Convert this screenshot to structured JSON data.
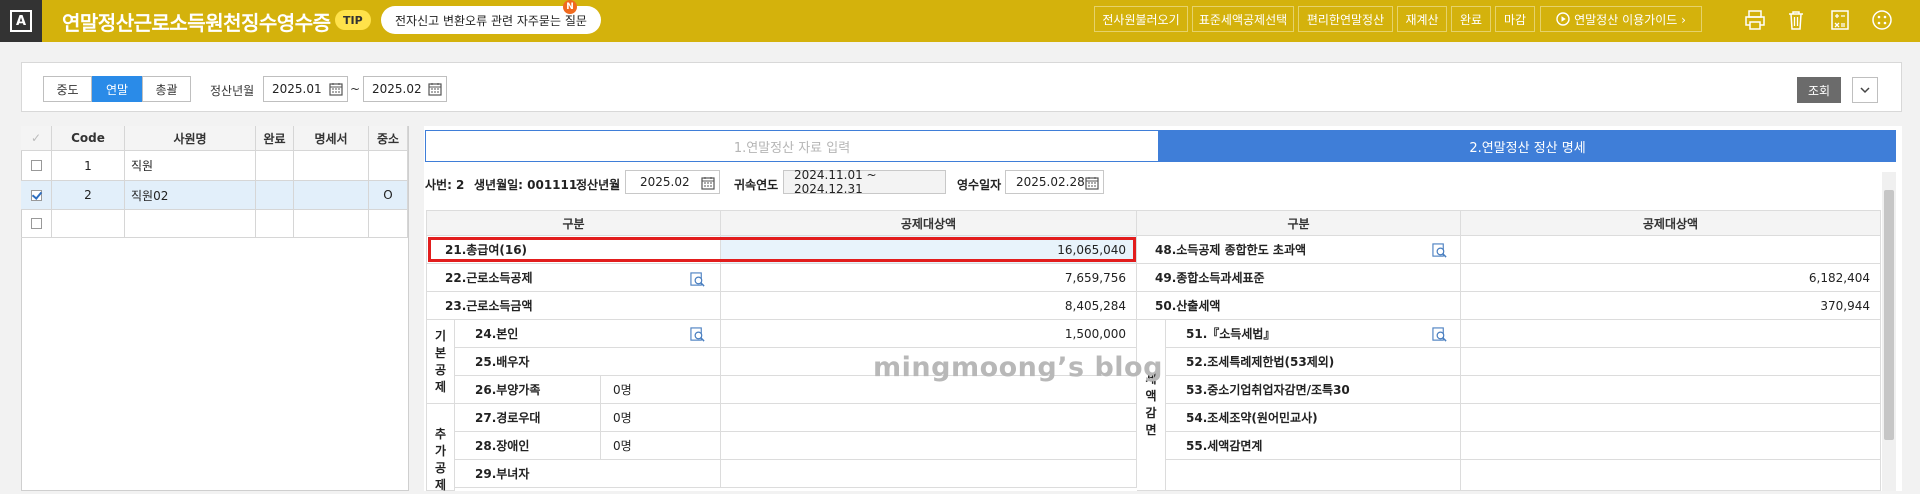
{
  "header": {
    "logo_letter": "A",
    "title": "연말정산근로소득원천징수영수증",
    "tip_badge": "TIP",
    "tip_text": "전자신고 변환오류 관련 자주묻는 질문",
    "new_badge": "N",
    "buttons": [
      "전사원불러오기",
      "표준세액공제선택",
      "편리한연말정산",
      "재계산",
      "완료",
      "마감"
    ],
    "guide_button": "연말정산 이용가이드 ›",
    "icons": [
      "print-icon",
      "trash-icon",
      "calculator-icon",
      "apps-icon"
    ]
  },
  "filter": {
    "segments": [
      "중도",
      "연말",
      "총괄"
    ],
    "active_segment": "연말",
    "period_label": "정산년월",
    "from": "2025.01",
    "tilde": "~",
    "to": "2025.02",
    "search_button": "조회"
  },
  "employees": {
    "columns": [
      "✓",
      "Code",
      "사원명",
      "완료",
      "명세서",
      "중소"
    ],
    "rows": [
      {
        "checked": false,
        "code": "1",
        "name": "직원",
        "done": "",
        "statement": "",
        "sme": ""
      },
      {
        "checked": true,
        "code": "2",
        "name": "직원02",
        "done": "",
        "statement": "",
        "sme": "O"
      },
      {
        "checked": false,
        "code": "",
        "name": "",
        "done": "",
        "statement": "",
        "sme": ""
      }
    ]
  },
  "tabs": [
    "1.연말정산 자료 입력",
    "2.연말정산 정산 명세"
  ],
  "info": {
    "emp_no": "사번: 2",
    "birth": "생년월일: 001111",
    "settle_label": "정산년월",
    "settle_value": "2025.02",
    "period_label": "귀속연도",
    "period_value": "2024.11.01 ~ 2024.12.31",
    "receipt_label": "영수일자",
    "receipt_value": "2025.02.28"
  },
  "table": {
    "headers": [
      "구분",
      "공제대상액",
      "구분",
      "공제대상액"
    ],
    "left_rows": [
      {
        "label": "21.총급여(16)",
        "value": "16,065,040"
      },
      {
        "label": "22.근로소득공제",
        "value": "7,659,756"
      },
      {
        "label": "23.근로소득금액",
        "value": "8,405,284"
      },
      {
        "label": "24.본인",
        "sub": "",
        "value": "1,500,000"
      },
      {
        "label": "25.배우자",
        "sub": "",
        "value": ""
      },
      {
        "label": "26.부양가족",
        "sub": "0명",
        "value": ""
      },
      {
        "label": "27.경로우대",
        "sub": "0명",
        "value": ""
      },
      {
        "label": "28.장애인",
        "sub": "0명",
        "value": ""
      },
      {
        "label": "29.부녀자",
        "sub": "",
        "value": ""
      }
    ],
    "left_group_basic": "기본공제",
    "left_group_extra": "추가공제",
    "right_rows": [
      {
        "label": "48.소득공제 종합한도 초과액",
        "value": ""
      },
      {
        "label": "49.종합소득과세표준",
        "value": "6,182,404"
      },
      {
        "label": "50.산출세액",
        "value": "370,944"
      },
      {
        "label": "51.『소득세법』",
        "value": ""
      },
      {
        "label": "52.조세특례제한법(53제외)",
        "value": ""
      },
      {
        "label": "53.중소기업취업자감면/조특30",
        "value": ""
      },
      {
        "label": "54.조세조약(원어민교사)",
        "value": ""
      },
      {
        "label": "55.세액감면계",
        "value": ""
      }
    ],
    "right_group": "세액감면"
  },
  "watermark": "mingmoong’s blog"
}
